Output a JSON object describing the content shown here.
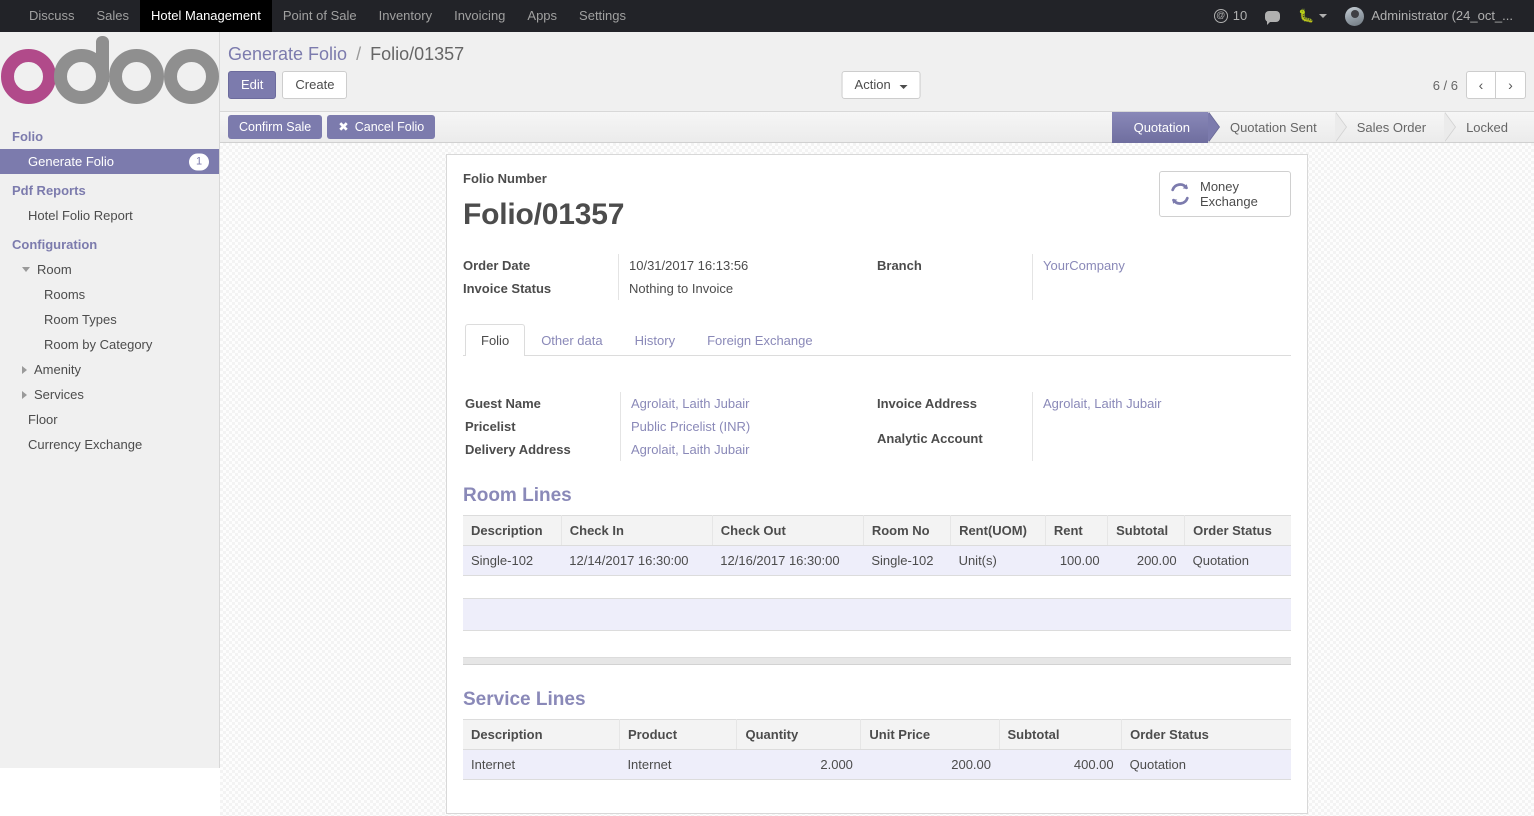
{
  "navbar": {
    "menus": [
      {
        "label": "Discuss",
        "active": false
      },
      {
        "label": "Sales",
        "active": false
      },
      {
        "label": "Hotel Management",
        "active": true
      },
      {
        "label": "Point of Sale",
        "active": false
      },
      {
        "label": "Inventory",
        "active": false
      },
      {
        "label": "Invoicing",
        "active": false
      },
      {
        "label": "Apps",
        "active": false
      },
      {
        "label": "Settings",
        "active": false
      }
    ],
    "mention_count": "10",
    "mention_icon": "at-sign-icon",
    "messages_icon": "chat-bubble-icon",
    "debug_icon": "bug-icon",
    "user_name": "Administrator (24_oct_...",
    "avatar_icon": "user-avatar"
  },
  "sidebar": {
    "logo_text": "odoo",
    "logo_accent_color": "#b14a8a",
    "logo_gray_color": "#8f8f8f",
    "sections": [
      {
        "title": "Folio",
        "items": [
          {
            "label": "Generate Folio",
            "active": true,
            "badge": "1",
            "indent": 1,
            "toggle": "none"
          }
        ]
      },
      {
        "title": "Pdf Reports",
        "items": [
          {
            "label": "Hotel Folio Report",
            "active": false,
            "badge": "",
            "indent": 1,
            "toggle": "none"
          }
        ]
      },
      {
        "title": "Configuration",
        "items": [
          {
            "label": "Room",
            "active": false,
            "badge": "",
            "indent": 0,
            "toggle": "open"
          },
          {
            "label": "Rooms",
            "active": false,
            "badge": "",
            "indent": 2,
            "toggle": "none"
          },
          {
            "label": "Room Types",
            "active": false,
            "badge": "",
            "indent": 2,
            "toggle": "none"
          },
          {
            "label": "Room by Category",
            "active": false,
            "badge": "",
            "indent": 2,
            "toggle": "none"
          },
          {
            "label": "Amenity",
            "active": false,
            "badge": "",
            "indent": 0,
            "toggle": "closed"
          },
          {
            "label": "Services",
            "active": false,
            "badge": "",
            "indent": 0,
            "toggle": "closed"
          },
          {
            "label": "Floor",
            "active": false,
            "badge": "",
            "indent": 1,
            "toggle": "none"
          },
          {
            "label": "Currency Exchange",
            "active": false,
            "badge": "",
            "indent": 1,
            "toggle": "none"
          }
        ]
      }
    ]
  },
  "control_panel": {
    "breadcrumb_root": "Generate Folio",
    "breadcrumb_sep": "/",
    "breadcrumb_current": "Folio/01357",
    "edit_label": "Edit",
    "create_label": "Create",
    "action_label": "Action",
    "pager_text": "6 / 6",
    "prev_icon": "chevron-left-icon",
    "next_icon": "chevron-right-icon"
  },
  "statusbar": {
    "buttons": [
      {
        "label": "Confirm Sale",
        "icon": ""
      },
      {
        "label": "Cancel Folio",
        "icon": "✖"
      }
    ],
    "stages": [
      {
        "label": "Quotation",
        "active": true
      },
      {
        "label": "Quotation Sent",
        "active": false
      },
      {
        "label": "Sales Order",
        "active": false
      },
      {
        "label": "Locked",
        "active": false
      }
    ],
    "active_color": "#7c7bad"
  },
  "form": {
    "folio_number_label": "Folio Number",
    "folio_number_value": "Folio/01357",
    "money_exchange_label_line1": "Money",
    "money_exchange_label_line2": "Exchange",
    "money_exchange_icon": "exchange-refresh-icon",
    "left_fields": [
      {
        "label": "Order Date",
        "value": "10/31/2017 16:13:56",
        "link": false
      },
      {
        "label": "Invoice Status",
        "value": "Nothing to Invoice",
        "link": false
      }
    ],
    "right_fields": [
      {
        "label": "Branch",
        "value": "YourCompany",
        "link": true
      }
    ],
    "tabs": [
      {
        "label": "Folio",
        "active": true
      },
      {
        "label": "Other data",
        "active": false
      },
      {
        "label": "History",
        "active": false
      },
      {
        "label": "Foreign Exchange",
        "active": false
      }
    ],
    "tab_left_fields": [
      {
        "label": "Guest Name",
        "value": "Agrolait, Laith Jubair",
        "link": true
      },
      {
        "label": "Pricelist",
        "value": "Public Pricelist (INR)",
        "link": true
      },
      {
        "label": "Delivery Address",
        "value": "Agrolait, Laith Jubair",
        "link": true
      }
    ],
    "tab_right_fields": [
      {
        "label": "Invoice Address",
        "value": "Agrolait, Laith Jubair",
        "link": true
      },
      {
        "label": "Analytic Account",
        "value": "",
        "link": false
      }
    ],
    "room_lines": {
      "title": "Room Lines",
      "columns": [
        "Description",
        "Check In",
        "Check Out",
        "Room No",
        "Rent(UOM)",
        "Rent",
        "Subtotal",
        "Order Status"
      ],
      "numeric_columns": [
        5,
        6
      ],
      "rows": [
        [
          "Single-102",
          "12/14/2017 16:30:00",
          "12/16/2017 16:30:00",
          "Single-102",
          "Unit(s)",
          "100.00",
          "200.00",
          "Quotation"
        ]
      ]
    },
    "service_lines": {
      "title": "Service Lines",
      "columns": [
        "Description",
        "Product",
        "Quantity",
        "Unit Price",
        "Subtotal",
        "Order Status"
      ],
      "numeric_columns": [
        2,
        3,
        4
      ],
      "rows": [
        [
          "Internet",
          "Internet",
          "2.000",
          "200.00",
          "400.00",
          "Quotation"
        ]
      ]
    }
  }
}
